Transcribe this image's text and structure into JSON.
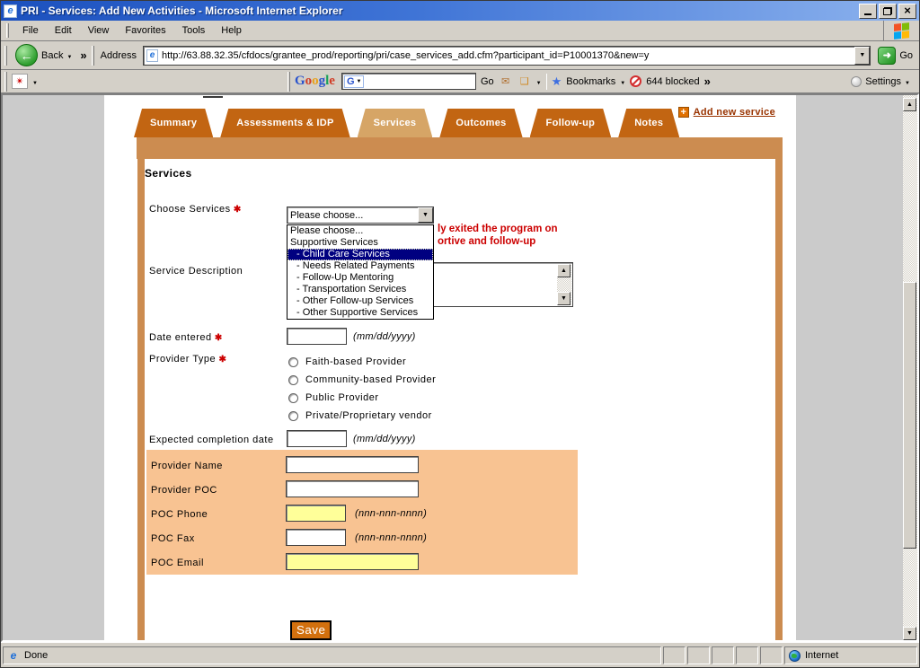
{
  "window": {
    "title": "PRI - Services: Add New Activities - Microsoft Internet Explorer",
    "status_left": "Done",
    "status_right": "Internet"
  },
  "menu_bar": {
    "items": [
      "File",
      "Edit",
      "View",
      "Favorites",
      "Tools",
      "Help"
    ]
  },
  "address_bar": {
    "back_label": "Back",
    "address_label": "Address",
    "url": "http://63.88.32.35/cfdocs/grantee_prod/reporting/pri/case_services_add.cfm?participant_id=P10001370&new=y",
    "go_label": "Go"
  },
  "google_toolbar": {
    "logo_letters": [
      "G",
      "o",
      "o",
      "g",
      "l",
      "e"
    ],
    "search_value": "",
    "go_label": "Go",
    "bookmarks_label": "Bookmarks",
    "blocked_label": "644 blocked",
    "settings_label": "Settings"
  },
  "tabs": [
    {
      "label": "Summary",
      "active": false
    },
    {
      "label": "Assessments & IDP",
      "active": false
    },
    {
      "label": "Services",
      "active": true
    },
    {
      "label": "Outcomes",
      "active": false
    },
    {
      "label": "Follow-up",
      "active": false
    },
    {
      "label": "Notes",
      "active": false
    }
  ],
  "add_new_service_label": "Add new service",
  "form": {
    "heading": "Services",
    "choose_services_label": "Choose Services",
    "select_value": "Please choose...",
    "dropdown_options": [
      "Please choose...",
      "Supportive Services",
      "- Child Care Services",
      "- Needs Related Payments",
      "- Follow-Up Mentoring",
      "- Transportation Services",
      "- Other Follow-up Services",
      "- Other Supportive Services"
    ],
    "selected_option": "- Child Care Services",
    "warning_fragments": [
      "ly exited the program on",
      "ortive and follow-up"
    ],
    "service_description_label": "Service Description",
    "date_entered_label": "Date entered",
    "date_format_hint": "(mm/dd/yyyy)",
    "provider_type_label": "Provider Type",
    "provider_type_options": [
      "Faith-based Provider",
      "Community-based Provider",
      "Public Provider",
      "Private/Proprietary vendor"
    ],
    "expected_completion_label": "Expected completion date",
    "provider_section": {
      "provider_name_label": "Provider Name",
      "provider_poc_label": "Provider POC",
      "poc_phone_label": "POC Phone",
      "poc_fax_label": "POC Fax",
      "poc_email_label": "POC Email",
      "phone_format_hint": "(nnn-nnn-nnnn)"
    },
    "save_label": "Save"
  },
  "colors": {
    "tab_orange": "#C26512",
    "tab_active_tan": "#D6A566",
    "band_tan": "#CC8C50",
    "peach_panel": "#F8C392",
    "yellow_input": "#FFFF99",
    "warning_red": "#CC0000",
    "link_maroon": "#993300",
    "highlight_navy": "#000080"
  }
}
